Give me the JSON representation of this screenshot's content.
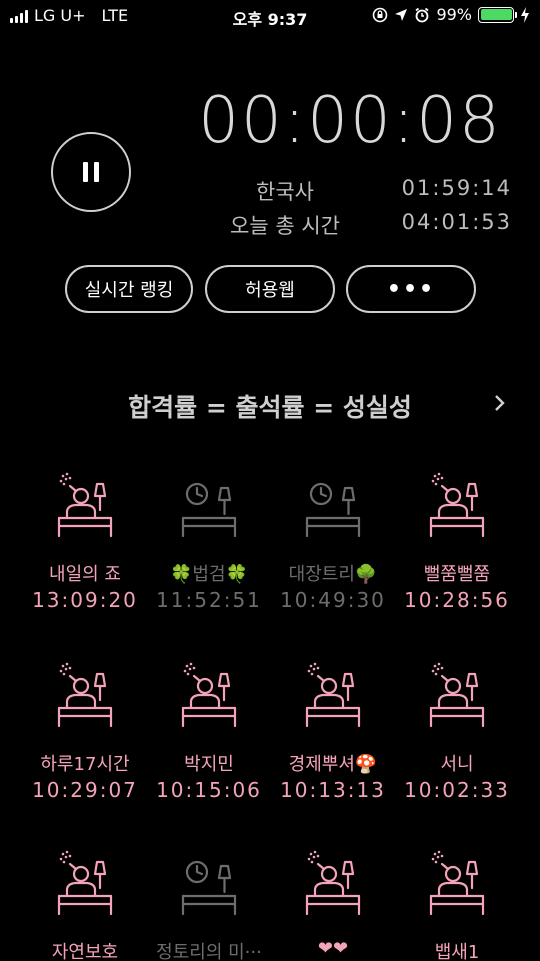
{
  "status_bar": {
    "carrier": "LG U+",
    "network": "LTE",
    "time": "오후 9:37",
    "battery": "99%"
  },
  "timer": {
    "elapsed": "00:00:08",
    "subject_label": "한국사",
    "subject_time": "01:59:14",
    "total_label": "오늘 총 시간",
    "total_time": "04:01:53"
  },
  "buttons": {
    "ranking": "실시간 랭킹",
    "web": "허용웹",
    "more": "•••"
  },
  "motto": "합격률 = 출석률 = 성실성",
  "members": [
    {
      "name": "내일의 죠",
      "time": "13:09:20",
      "status": "active"
    },
    {
      "name": "🍀법검🍀",
      "time": "11:52:51",
      "status": "idle"
    },
    {
      "name": "대장트리🌳",
      "time": "10:49:30",
      "status": "idle"
    },
    {
      "name": "뻘쭘뻘쭘",
      "time": "10:28:56",
      "status": "active"
    },
    {
      "name": "하루17시간",
      "time": "10:29:07",
      "status": "active"
    },
    {
      "name": "박지민",
      "time": "10:15:06",
      "status": "active"
    },
    {
      "name": "경제뿌셔🍄",
      "time": "10:13:13",
      "status": "active"
    },
    {
      "name": "서니",
      "time": "10:02:33",
      "status": "active"
    },
    {
      "name": "자연보호",
      "time": "",
      "status": "active"
    },
    {
      "name": "정토리의 미···",
      "time": "",
      "status": "idle"
    },
    {
      "name": "❤❤",
      "time": "",
      "status": "active"
    },
    {
      "name": "뱁새1",
      "time": "",
      "status": "active"
    }
  ],
  "colors": {
    "active": "#f3a4b8",
    "idle": "#6d6d6d",
    "battery": "#4cd964"
  }
}
